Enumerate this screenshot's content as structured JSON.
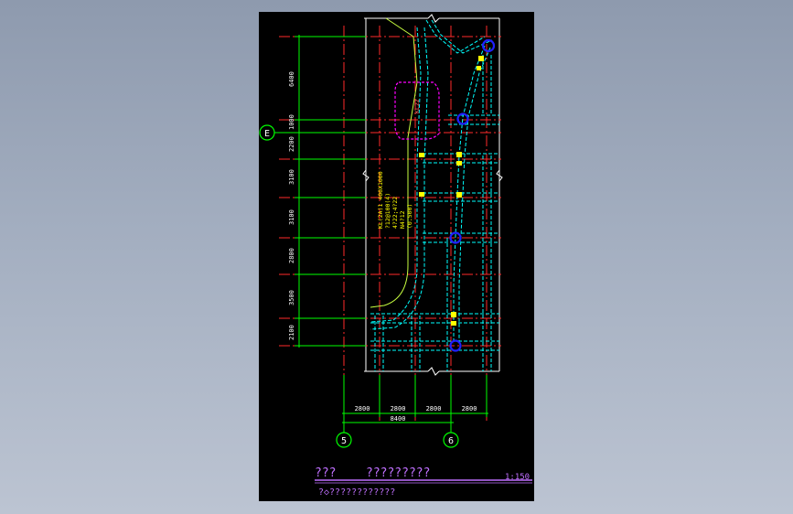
{
  "drawing": {
    "row_dimensions": [
      "6400",
      "1000",
      "2200",
      "3100",
      "3100",
      "2800",
      "3500",
      "2100"
    ],
    "column_dimensions": [
      "2800",
      "2800",
      "2800",
      "2800"
    ],
    "total_dimension": "8400",
    "axis_labels": {
      "row_e": "E",
      "col_5": "5",
      "col_6": "6"
    },
    "beam_tag": "KL22",
    "beam_annotation": [
      "KL(2A)1 400X1000",
      "?12@100(4)",
      "4?22;4?22",
      "N4?12",
      "(0.500)"
    ]
  },
  "title_block": {
    "title_left": "???",
    "title_main": "?????????",
    "scale": "1:150",
    "subtitle": "?◇????????????"
  },
  "colors": {
    "background": "#000000",
    "grid_red": "#ff2a2a",
    "dim_green": "#00ff00",
    "cyan": "#00ffff",
    "yellow": "#ffff00",
    "magenta": "#ff00ff",
    "title_purple": "#b060ff",
    "node_blue": "#2020ff"
  }
}
